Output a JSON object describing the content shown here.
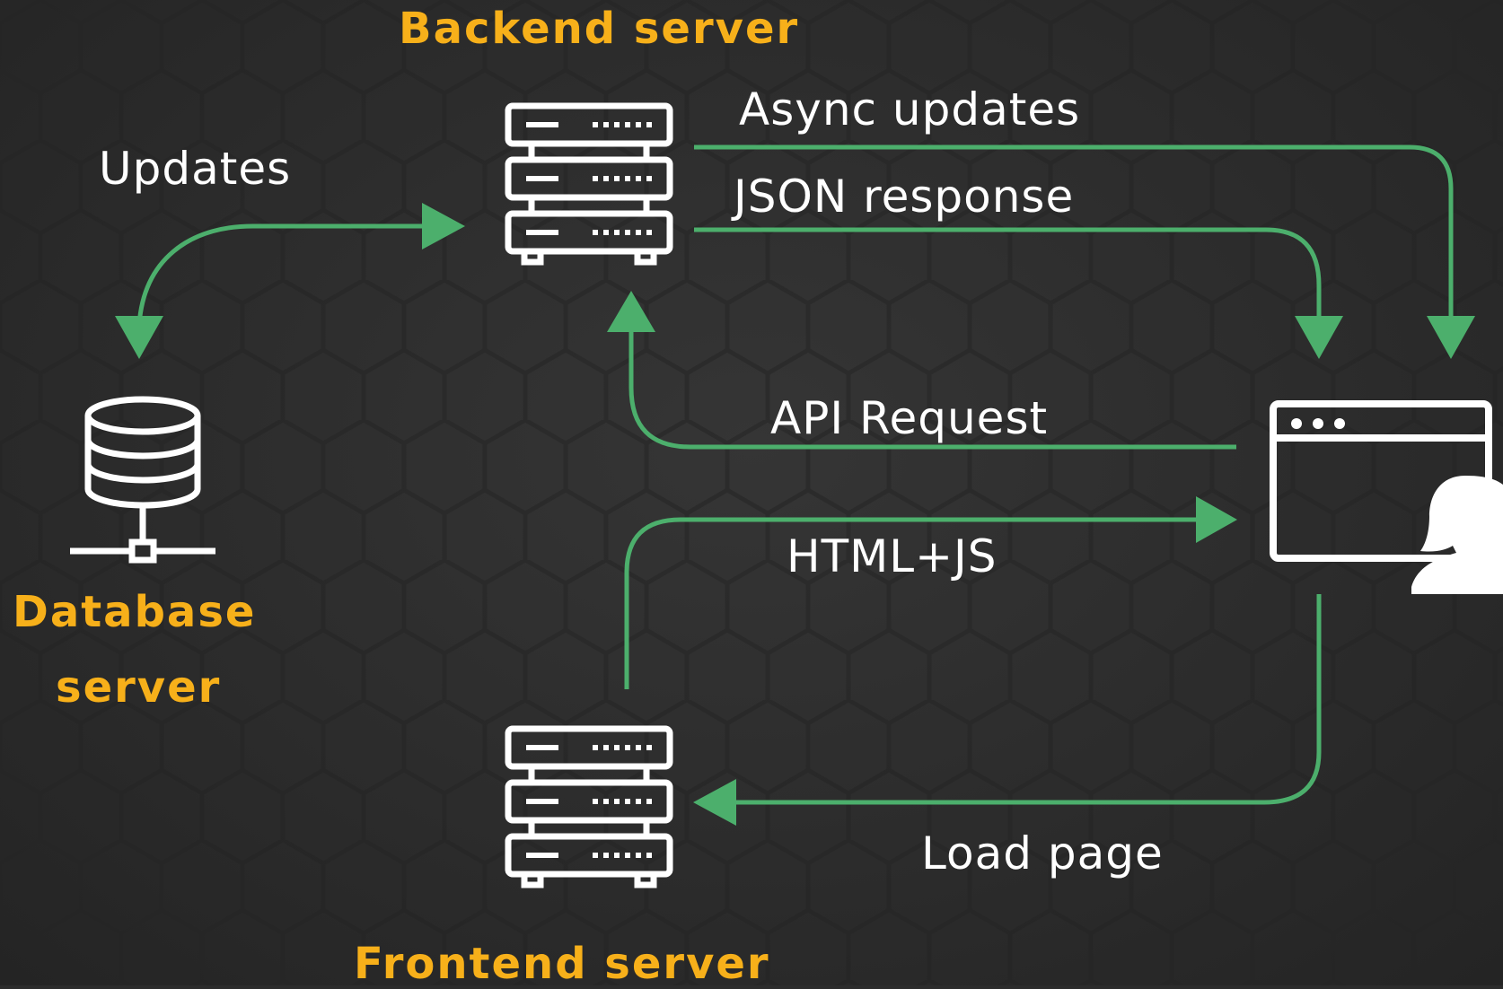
{
  "diagram": {
    "colors": {
      "background": "#2c2c2c",
      "arrow": "#4caf6c",
      "icon": "#ffffff",
      "title_text": "#f7b01a",
      "label_text": "#ffffff"
    },
    "nodes": {
      "backend": {
        "title": "Backend server",
        "icon": "server-rack-icon"
      },
      "database": {
        "title_line1": "Database",
        "title_line2": "server",
        "icon": "database-icon"
      },
      "frontend": {
        "title": "Frontend server",
        "icon": "server-rack-icon"
      },
      "client": {
        "icon": "browser-window-icon",
        "user_icon": "user-icon"
      }
    },
    "edges": {
      "updates": "Updates",
      "async_updates": "Async updates",
      "json_response": "JSON response",
      "api_request": "API Request",
      "html_js": "HTML+JS",
      "load_page": "Load page"
    }
  }
}
